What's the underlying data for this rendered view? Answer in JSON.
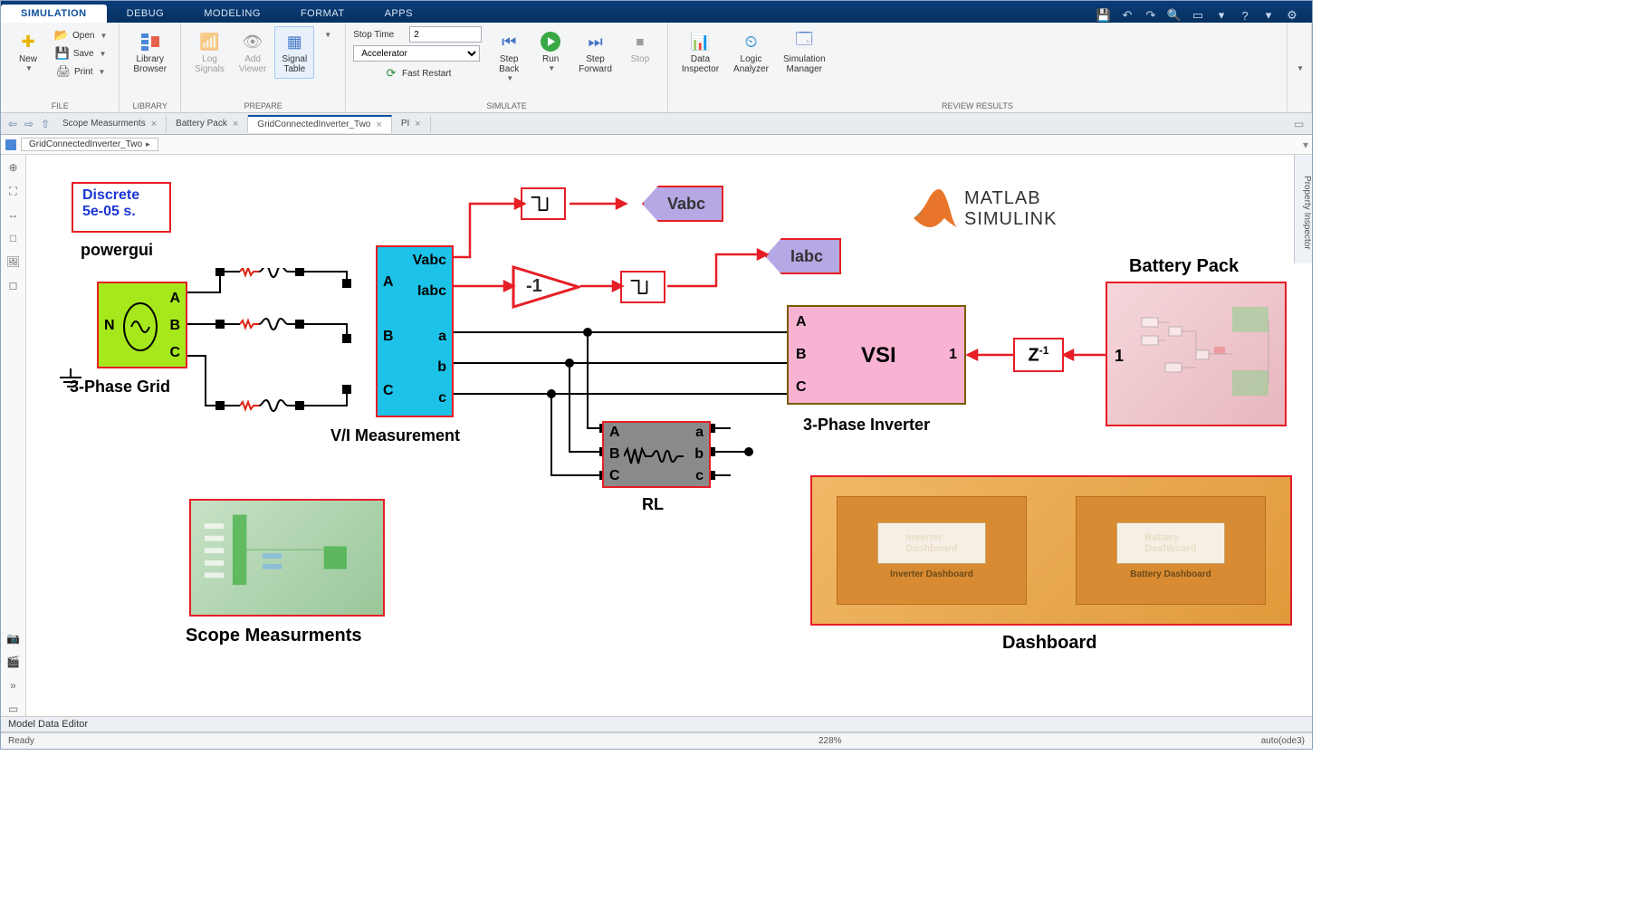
{
  "tabs": [
    "SIMULATION",
    "DEBUG",
    "MODELING",
    "FORMAT",
    "APPS"
  ],
  "activeTab": "SIMULATION",
  "ribbon": {
    "file": {
      "title": "FILE",
      "new": "New",
      "open": "Open",
      "save": "Save",
      "print": "Print"
    },
    "library": {
      "title": "LIBRARY",
      "browser": "Library\nBrowser"
    },
    "prepare": {
      "title": "PREPARE",
      "log": "Log\nSignals",
      "add": "Add\nViewer",
      "table": "Signal\nTable"
    },
    "simulate": {
      "title": "SIMULATE",
      "stoptime_label": "Stop Time",
      "stoptime": "2",
      "mode": "Accelerator",
      "restart": "Fast Restart",
      "stepback": "Step\nBack",
      "run": "Run",
      "stepfwd": "Step\nForward",
      "stop": "Stop"
    },
    "review": {
      "title": "REVIEW RESULTS",
      "data": "Data\nInspector",
      "logic": "Logic\nAnalyzer",
      "sim": "Simulation\nManager"
    }
  },
  "doctabs": [
    "Scope Measurments",
    "Battery Pack",
    "GridConnectedInverter_Two",
    "PI"
  ],
  "activeDoc": "GridConnectedInverter_Two",
  "crumb": "GridConnectedInverter_Two",
  "propPanel": "Property Inspector",
  "blocks": {
    "powergui": {
      "line1": "Discrete",
      "line2": "5e-05 s.",
      "label": "powergui"
    },
    "grid": {
      "N": "N",
      "A": "A",
      "B": "B",
      "C": "C",
      "label": "3-Phase Grid"
    },
    "vi": {
      "A": "A",
      "B": "B",
      "C": "C",
      "Vabc": "Vabc",
      "Iabc": "Iabc",
      "a": "a",
      "b": "b",
      "c": "c",
      "label": "V/I Measurement"
    },
    "gain": "-1",
    "rl": {
      "A": "A",
      "B": "B",
      "C": "C",
      "a": "a",
      "b": "b",
      "c": "c",
      "label": "RL"
    },
    "vsi": {
      "A": "A",
      "B": "B",
      "C": "C",
      "text": "VSI",
      "one": "1",
      "label": "3-Phase Inverter"
    },
    "delay": {
      "text": "Z",
      "sup": "-1"
    },
    "battery": {
      "label": "Battery Pack",
      "one": "1"
    },
    "scope": {
      "label": "Scope Measurments"
    },
    "dash": {
      "label": "Dashboard",
      "inv": "Inverter Dashboard",
      "bat": "Battery Dashboard"
    },
    "tagV": "Vabc",
    "tagI": "Iabc",
    "matlab": {
      "line1": "MATLAB",
      "line2": "SIMULINK"
    }
  },
  "editor": "Model Data Editor",
  "status": {
    "ready": "Ready",
    "zoom": "228%",
    "solver": "auto(ode3)"
  }
}
